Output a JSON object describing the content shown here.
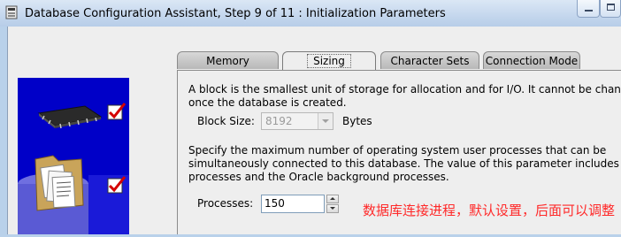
{
  "window": {
    "title": "Database Configuration Assistant, Step 9 of 11 : Initialization Parameters",
    "icons": [
      "database-app-icon",
      "minimize-icon",
      "maximize-icon"
    ]
  },
  "tabs": [
    {
      "label": "Memory",
      "active": false
    },
    {
      "label": "Sizing",
      "active": true
    },
    {
      "label": "Character Sets",
      "active": false
    },
    {
      "label": "Connection Mode",
      "active": false
    }
  ],
  "sizing": {
    "block_intro_line1": "A block is the smallest unit of storage for allocation and for I/O. It cannot be changed",
    "block_intro_line2": "once the database is created.",
    "block_size_label": "Block Size:",
    "block_size_value": "8192",
    "block_size_unit": "Bytes",
    "process_intro_line1": "Specify the maximum number of operating system user processes that can be",
    "process_intro_line2": "simultaneously connected to this database. The value of this parameter includes the",
    "process_intro_line3": "processes and the Oracle background processes.",
    "processes_label": "Processes:",
    "processes_value": "150"
  },
  "annotation": {
    "text": "数据库连接进程，默认设置，后面可以调整",
    "color": "#ff2a2a"
  },
  "sidebar": {
    "icons": [
      "memory-chip-icon",
      "checkmark-icon",
      "documents-folder-icon",
      "checkmark-icon"
    ],
    "background_color": "#0000c8"
  }
}
